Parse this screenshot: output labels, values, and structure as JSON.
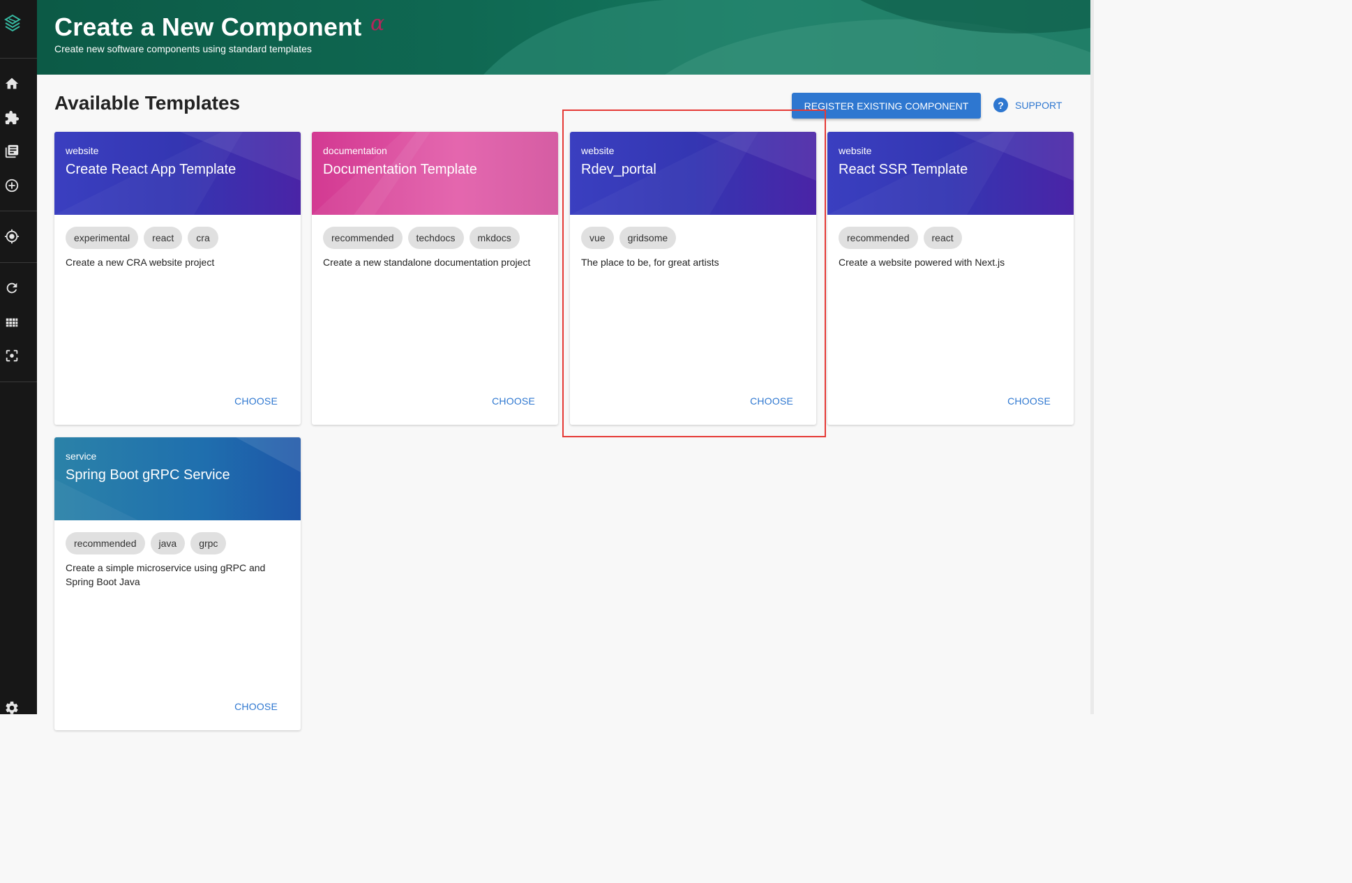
{
  "header": {
    "title": "Create a New Component",
    "alpha": "α",
    "subtitle": "Create new software components using standard templates"
  },
  "sidebar": {
    "items": [
      {
        "icon": "home-icon"
      },
      {
        "icon": "puzzle-icon"
      },
      {
        "icon": "library-icon"
      },
      {
        "icon": "add-circle-icon"
      },
      {
        "icon": "location-target-icon"
      },
      {
        "icon": "refresh-icon"
      },
      {
        "icon": "grid-icon"
      },
      {
        "icon": "center-focus-icon"
      },
      {
        "icon": "settings-icon"
      }
    ]
  },
  "main": {
    "section_title": "Available Templates",
    "register_button": "REGISTER EXISTING COMPONENT",
    "support_label": "SUPPORT",
    "support_icon": "?"
  },
  "templates": [
    {
      "type": "website",
      "title": "Create React App Template",
      "tags": [
        "experimental",
        "react",
        "cra"
      ],
      "description": "Create a new CRA website project",
      "action": "CHOOSE",
      "theme": "blue"
    },
    {
      "type": "documentation",
      "title": "Documentation Template",
      "tags": [
        "recommended",
        "techdocs",
        "mkdocs"
      ],
      "description": "Create a new standalone documentation project",
      "action": "CHOOSE",
      "theme": "pink"
    },
    {
      "type": "website",
      "title": "Rdev_portal",
      "tags": [
        "vue",
        "gridsome"
      ],
      "description": "The place to be, for great artists",
      "action": "CHOOSE",
      "theme": "blue"
    },
    {
      "type": "website",
      "title": "React SSR Template",
      "tags": [
        "recommended",
        "react"
      ],
      "description": "Create a website powered with Next.js",
      "action": "CHOOSE",
      "theme": "blue"
    },
    {
      "type": "service",
      "title": "Spring Boot gRPC Service",
      "tags": [
        "recommended",
        "java",
        "grpc"
      ],
      "description": "Create a simple microservice using gRPC and Spring Boot Java",
      "action": "CHOOSE",
      "theme": "teal"
    }
  ],
  "colors": {
    "header_green": "#0f6852",
    "accent_blue": "#2e77d0",
    "alpha_red": "#b3255a",
    "highlight_red": "#e53935"
  }
}
